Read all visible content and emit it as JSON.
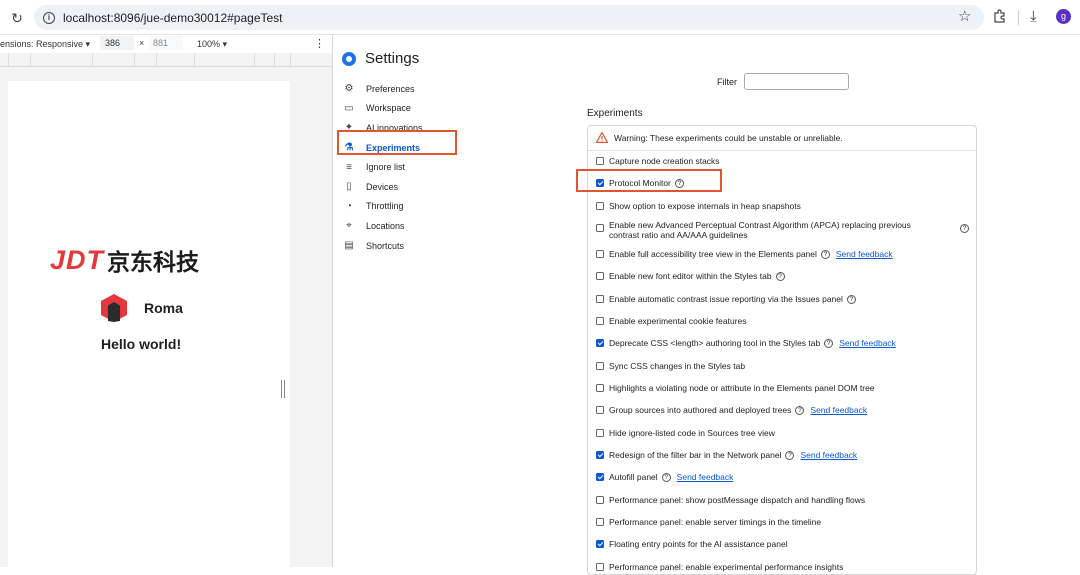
{
  "browser": {
    "url": "localhost:8096/jue-demo30012#pageTest",
    "profile_initial": "g",
    "icons": [
      "reload-icon",
      "info-icon",
      "star-icon",
      "extensions-icon",
      "download-icon"
    ]
  },
  "device_toolbar": {
    "dimensions_label": "ensions: Responsive ▾",
    "width": "386",
    "times": "×",
    "height": "881",
    "zoom": "100% ▾",
    "more": "⋮"
  },
  "page": {
    "logo_latin": "JDT",
    "logo_cn": "京东科技",
    "roma_label": "Roma",
    "hello": "Hello world!"
  },
  "settings": {
    "title": "Settings",
    "nav": [
      {
        "label": "Preferences",
        "icon": "gear-icon",
        "glyph": "⚙"
      },
      {
        "label": "Workspace",
        "icon": "folder-icon",
        "glyph": "▭"
      },
      {
        "label": "AI innovations",
        "icon": "sparkle-icon",
        "glyph": "✦"
      },
      {
        "label": "Experiments",
        "icon": "flask-icon",
        "glyph": "⚗"
      },
      {
        "label": "Ignore list",
        "icon": "ignore-list-icon",
        "glyph": "≡"
      },
      {
        "label": "Devices",
        "icon": "devices-icon",
        "glyph": "▯"
      },
      {
        "label": "Throttling",
        "icon": "gauge-icon",
        "glyph": "◔"
      },
      {
        "label": "Locations",
        "icon": "pin-icon",
        "glyph": "⌖"
      },
      {
        "label": "Shortcuts",
        "icon": "keyboard-icon",
        "glyph": "▤"
      }
    ],
    "filter_label": "Filter",
    "filter_value": "",
    "experiments_title": "Experiments",
    "warning": "Warning: These experiments could be unstable or unreliable.",
    "send_feedback": "Send feedback",
    "experiments": [
      {
        "label": "Capture node creation stacks",
        "checked": false
      },
      {
        "label": "Protocol Monitor",
        "checked": true,
        "help": true
      },
      {
        "label": "Show option to expose internals in heap snapshots",
        "checked": false
      },
      {
        "label": "Enable new Advanced Perceptual Contrast Algorithm (APCA) replacing previous contrast ratio and AA/AAA guidelines",
        "checked": false,
        "help": true
      },
      {
        "label": "Enable full accessibility tree view in the Elements panel",
        "checked": false,
        "help": true,
        "feedback": true
      },
      {
        "label": "Enable new font editor within the Styles tab",
        "checked": false,
        "help": true
      },
      {
        "label": "Enable automatic contrast issue reporting via the Issues panel",
        "checked": false,
        "help": true
      },
      {
        "label": "Enable experimental cookie features",
        "checked": false
      },
      {
        "label": "Deprecate CSS <length> authoring tool in the Styles tab",
        "checked": true,
        "help": true,
        "feedback": true
      },
      {
        "label": "Sync CSS changes in the Styles tab",
        "checked": false
      },
      {
        "label": "Highlights a violating node or attribute in the Elements panel DOM tree",
        "checked": false
      },
      {
        "label": "Group sources into authored and deployed trees",
        "checked": false,
        "help": true,
        "feedback": true
      },
      {
        "label": "Hide ignore-listed code in Sources tree view",
        "checked": false
      },
      {
        "label": "Redesign of the filter bar in the Network panel",
        "checked": true,
        "help": true,
        "feedback": true
      },
      {
        "label": "Autofill panel",
        "checked": true,
        "help": true,
        "feedback": true
      },
      {
        "label": "Performance panel: show postMessage dispatch and handling flows",
        "checked": false
      },
      {
        "label": "Performance panel: enable server timings in the timeline",
        "checked": false
      },
      {
        "label": "Floating entry points for the AI assistance panel",
        "checked": true
      },
      {
        "label": "Performance panel: enable experimental performance insights",
        "checked": false
      }
    ]
  },
  "colors": {
    "highlight": "#e0562e",
    "accent": "#0b57d0",
    "brand_red": "#e4393c"
  }
}
